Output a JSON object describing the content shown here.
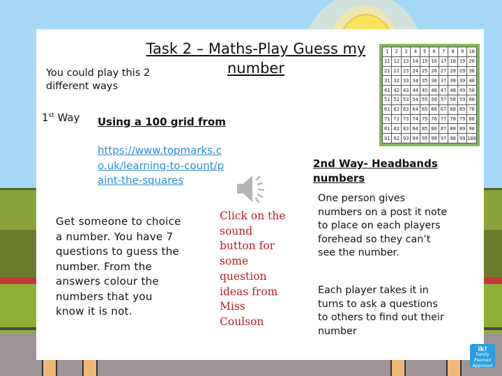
{
  "slide": {
    "title": "Task 2 – Maths-Play Guess my number",
    "intro": "You could play  this 2 different ways",
    "way1": {
      "label": "1",
      "label_sup": "st",
      "label_suffix": " Way",
      "heading": "Using a 100 grid from",
      "link": "https://www.topmarks.co.uk/learning-to-count/paint-the-squares",
      "body": "Get someone to choice a number. You have 7 questions to guess the number. From the answers colour the numbers that you know it is not."
    },
    "sound": {
      "icon": "speaker-icon",
      "note": "Click on the sound button for some question ideas from Miss Coulson"
    },
    "hundred_grid": {
      "cells": [
        1,
        2,
        3,
        4,
        5,
        6,
        7,
        8,
        9,
        10,
        11,
        12,
        13,
        14,
        15,
        16,
        17,
        18,
        19,
        20,
        21,
        22,
        23,
        24,
        25,
        26,
        27,
        28,
        29,
        30,
        31,
        32,
        33,
        34,
        35,
        36,
        37,
        38,
        39,
        40,
        41,
        42,
        43,
        44,
        45,
        46,
        47,
        48,
        49,
        50,
        51,
        52,
        53,
        54,
        55,
        56,
        57,
        58,
        59,
        60,
        61,
        62,
        63,
        64,
        65,
        66,
        67,
        68,
        69,
        70,
        71,
        72,
        73,
        74,
        75,
        76,
        77,
        78,
        79,
        80,
        81,
        82,
        83,
        84,
        85,
        86,
        87,
        88,
        89,
        90,
        91,
        92,
        93,
        94,
        95,
        96,
        97,
        98,
        99,
        100
      ],
      "border_color": "#7fb857"
    },
    "way2": {
      "heading": "2nd Way- Headbands numbers",
      "body1": "One person gives numbers on a post it note to place on each players forehead so they can’t see the number.",
      "body2": "Each player takes it in turns to ask a questions to others to find out their number"
    },
    "badge": {
      "line1": "ik!",
      "line2": "Family Planned Approved"
    }
  },
  "colors": {
    "sky": "#a5d8f5",
    "link": "#2a8ed6",
    "note": "#b22121"
  }
}
